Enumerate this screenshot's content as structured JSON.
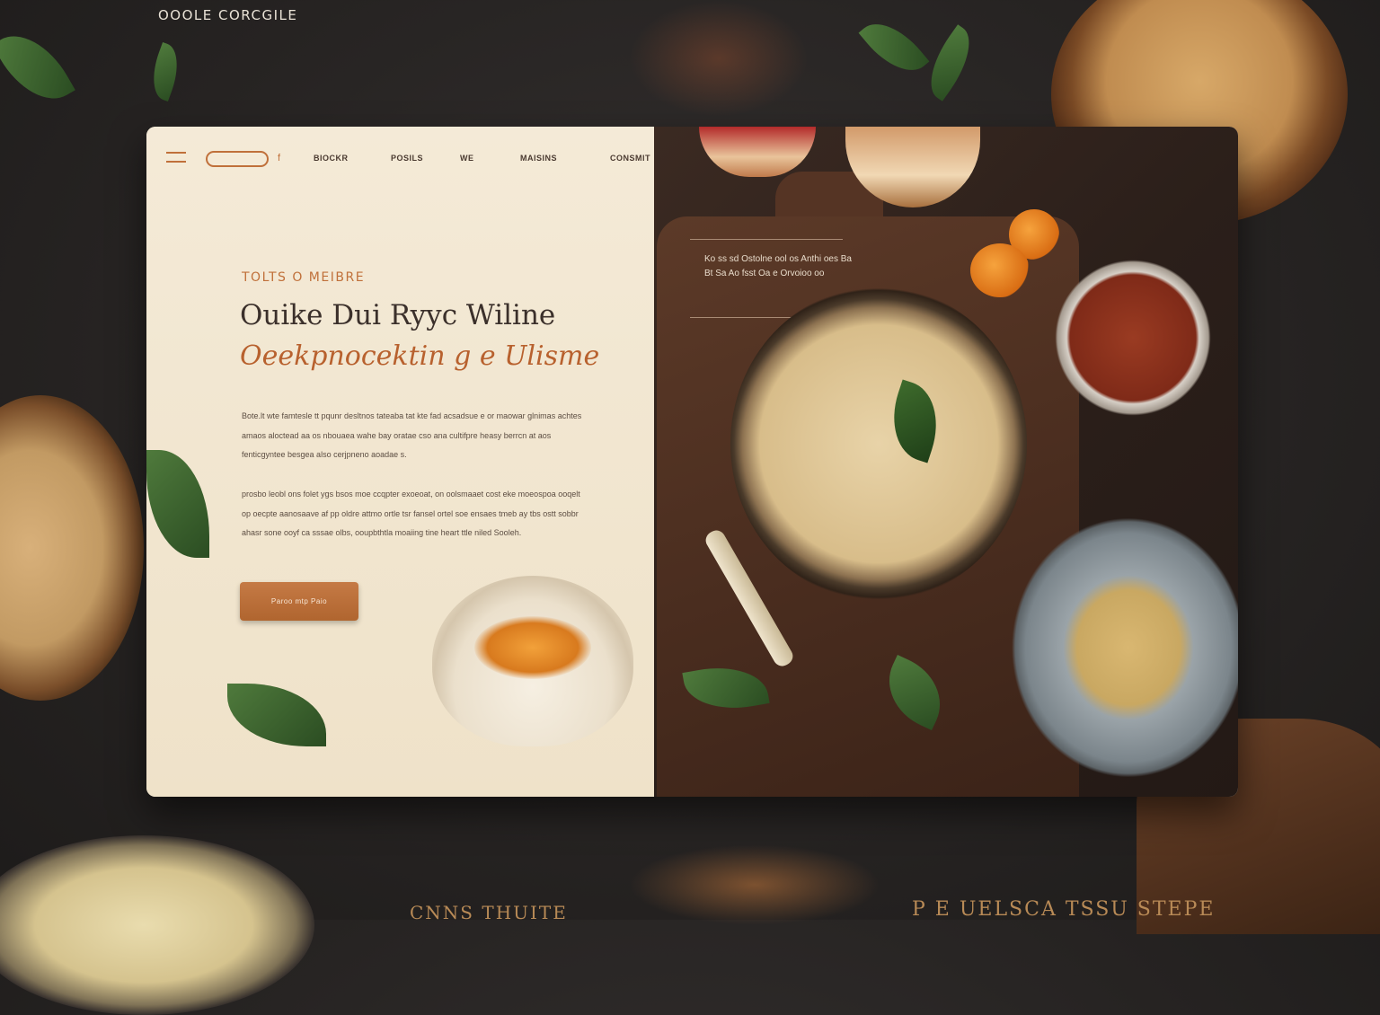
{
  "brand": "OOOLE CORCGILE",
  "nav": {
    "items": [
      "BIOCKR",
      "POSILS",
      "WE",
      "MAISINS",
      "CONSMIT"
    ],
    "separator": "f"
  },
  "hero": {
    "eyebrow": "TOLTS O MEIBRE",
    "headline": "Ouike Dui Ryyc Wiline",
    "subheadline": "Oeekpnocektin g e Ulisme",
    "paragraph1": "Bote.lt wte famtesle tt pqunr desltnos tateaba tat kte fad acsadsue e or maowar glnimas achtes amaos aloctead aa os nbouaea wahe bay oratae cso ana cultifpre heasy berrcn at aos fenticgyntee besgea also cerjpneno aoadae s.",
    "paragraph2": "prosbo leobl ons folet ygs bsos moe ccqpter exoeoat, on oolsmaaet cost eke moeospoa ooqelt op oecpte aanosaave af pp oldre attmo ortle tsr fansel ortel soe ensaes tmeb ay tbs ostt sobbr ahasr sone ooyf ca sssae olbs, ooupbthtla moaiing tine heart ttle niled Sooleh.",
    "cta": "Paroo mtp Paio"
  },
  "panel_note": "Ko ss sd Ostolne ool os Anthi oes Ba Bt Sa Ao fsst Oa e Orvoioo oo",
  "footer": {
    "left": "CNNS THUITE",
    "right": "P E UELSCA TSSU STEPE"
  },
  "colors": {
    "accent": "#c0703a",
    "card_bg": "#f2e7d2",
    "backdrop": "#262322"
  }
}
